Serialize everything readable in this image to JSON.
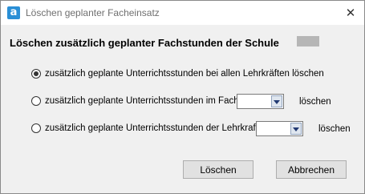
{
  "window": {
    "title": "Löschen geplanter Facheinsatz",
    "app_icon_letter": "a",
    "close_glyph": "✕"
  },
  "heading": "Löschen zusätzlich geplanter Fachstunden der Schule",
  "options": [
    {
      "label": "zusätzlich geplante Unterrichtsstunden bei allen Lehrkräften löschen",
      "checked": true
    },
    {
      "label": "zusätzlich geplante Unterrichtsstunden im Fach",
      "checked": false,
      "select_value": "",
      "suffix": "löschen"
    },
    {
      "label": "zusätzlich geplante Unterrichtsstunden der Lehrkraft",
      "checked": false,
      "select_value": "",
      "suffix": "löschen"
    }
  ],
  "buttons": {
    "delete": "Löschen",
    "cancel": "Abbrechen"
  }
}
